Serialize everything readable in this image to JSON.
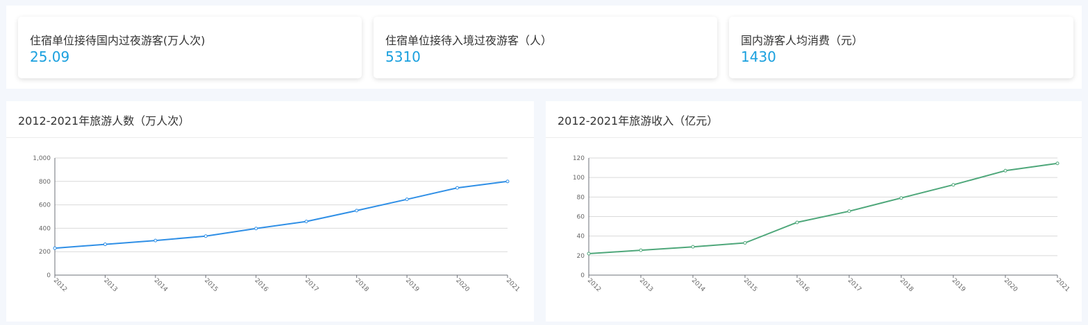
{
  "stats": [
    {
      "label": "住宿单位接待国内过夜游客(万人次)",
      "value": "25.09"
    },
    {
      "label": "住宿单位接待入境过夜游客（人）",
      "value": "5310"
    },
    {
      "label": "国内游客人均消费（元）",
      "value": "1430"
    }
  ],
  "panels": [
    {
      "title": "2012-2021年旅游人数（万人次）"
    },
    {
      "title": "2012-2021年旅游收入（亿元）"
    }
  ],
  "chart_data": [
    {
      "type": "line",
      "title": "2012-2021年旅游人数（万人次）",
      "categories": [
        "2012",
        "2013",
        "2014",
        "2015",
        "2016",
        "2017",
        "2018",
        "2019",
        "2020",
        "2021"
      ],
      "series": [
        {
          "values": [
            230,
            263,
            295,
            333,
            398,
            458,
            551,
            647,
            745,
            800
          ]
        }
      ],
      "ylim": [
        0,
        1000
      ],
      "yticks": [
        0,
        200,
        400,
        600,
        800,
        1000
      ],
      "ytick_labels": [
        "0",
        "200",
        "400",
        "600",
        "800",
        "1,000"
      ],
      "grid": true,
      "color": "#2f8fe6"
    },
    {
      "type": "line",
      "title": "2012-2021年旅游收入（亿元）",
      "categories": [
        "2012",
        "2013",
        "2014",
        "2015",
        "2016",
        "2017",
        "2018",
        "2019",
        "2020",
        "2021"
      ],
      "series": [
        {
          "values": [
            22,
            25.5,
            29,
            33,
            54,
            65.5,
            79,
            92.5,
            107,
            114.5
          ]
        }
      ],
      "ylim": [
        0,
        120
      ],
      "yticks": [
        0,
        20,
        40,
        60,
        80,
        100,
        120
      ],
      "ytick_labels": [
        "0",
        "20",
        "40",
        "60",
        "80",
        "100",
        "120"
      ],
      "grid": true,
      "color": "#4ea77a"
    }
  ]
}
